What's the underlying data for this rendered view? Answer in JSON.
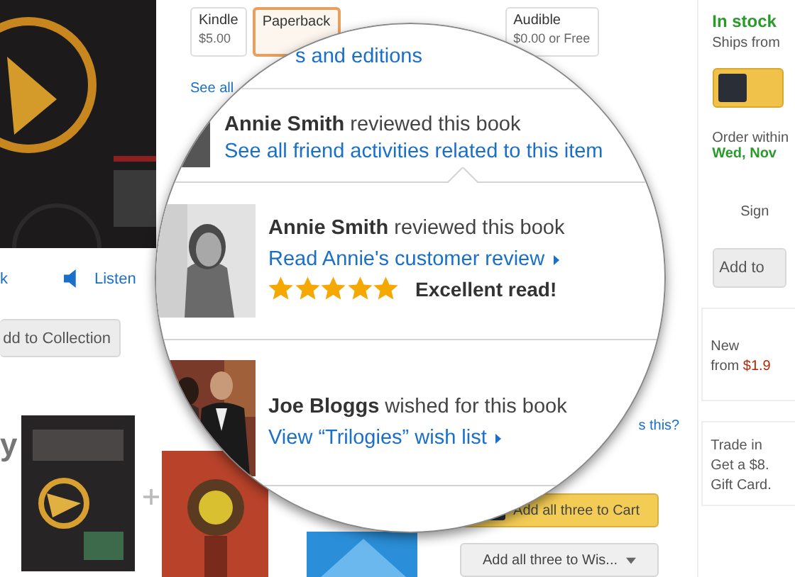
{
  "left": {
    "link": "k",
    "listen": "Listen",
    "collection_button": "dd to Collection",
    "heading": "y"
  },
  "tabs": [
    {
      "label": "Kindle",
      "price": "$5.00",
      "selected": false
    },
    {
      "label": "Paperback",
      "selected": true
    },
    {
      "label": "Audible",
      "price": "$0.00 or Free",
      "selected": false
    }
  ],
  "see_all": "See all",
  "whats_this": "s this?",
  "bundle_buttons": [
    {
      "kind": "cart",
      "label": "Add all three to Cart"
    },
    {
      "kind": "wishlist",
      "label": "Add all three to Wis..."
    }
  ],
  "buy_box": {
    "stock": "In stock",
    "ships": "Ships from",
    "order": "Order within",
    "date": "Wed, Nov",
    "sign": "Sign",
    "add_button": "Add to"
  },
  "offer": {
    "label": "New",
    "prefix": "from",
    "price": "$1.9"
  },
  "trade_in": [
    "Trade in",
    "Get a $8.",
    "Gift Card."
  ],
  "magnifier": {
    "editions_link": "s and editions",
    "summary": {
      "text": "**Annie Smith** reviewed this book",
      "link": "See all friend activities related to this item"
    },
    "activities": [
      {
        "kind": "review",
        "text": "**Annie Smith** reviewed this book",
        "link": "Read Annie's customer review",
        "stars": 5,
        "review_title": "Excellent read!"
      },
      {
        "kind": "wish",
        "text": "**Joe Bloggs** wished for this book",
        "link": "View “Trilogies” wish list"
      }
    ]
  }
}
